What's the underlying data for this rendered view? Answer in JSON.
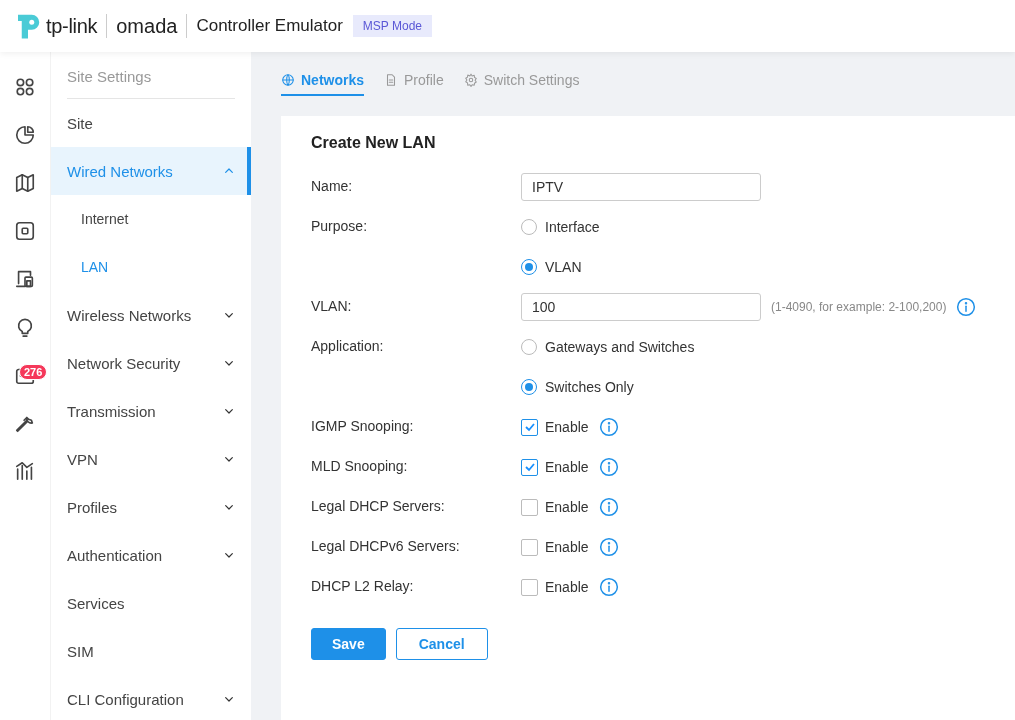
{
  "header": {
    "brand": "tp-link",
    "product": "omada",
    "title": "Controller Emulator",
    "mode_badge": "MSP Mode"
  },
  "rail": [
    {
      "kind": "dashboard"
    },
    {
      "kind": "statistics"
    },
    {
      "kind": "map"
    },
    {
      "kind": "devices"
    },
    {
      "kind": "clients"
    },
    {
      "kind": "insights"
    },
    {
      "kind": "logs",
      "badge": "276"
    },
    {
      "kind": "tools"
    },
    {
      "kind": "reports"
    }
  ],
  "sidebar": {
    "heading": "Site Settings",
    "items": [
      {
        "label": "Site",
        "kind": "link",
        "selected": false
      },
      {
        "label": "Wired Networks",
        "kind": "group",
        "selected": true,
        "expanded": true,
        "children": [
          {
            "label": "Internet",
            "selected": false
          },
          {
            "label": "LAN",
            "selected": true
          }
        ]
      },
      {
        "label": "Wireless Networks",
        "kind": "group",
        "selected": false,
        "expanded": false
      },
      {
        "label": "Network Security",
        "kind": "group",
        "selected": false,
        "expanded": false
      },
      {
        "label": "Transmission",
        "kind": "group",
        "selected": false,
        "expanded": false
      },
      {
        "label": "VPN",
        "kind": "group",
        "selected": false,
        "expanded": false
      },
      {
        "label": "Profiles",
        "kind": "group",
        "selected": false,
        "expanded": false
      },
      {
        "label": "Authentication",
        "kind": "group",
        "selected": false,
        "expanded": false
      },
      {
        "label": "Services",
        "kind": "link",
        "selected": false
      },
      {
        "label": "SIM",
        "kind": "link",
        "selected": false
      },
      {
        "label": "CLI Configuration",
        "kind": "group",
        "selected": false,
        "expanded": false
      }
    ]
  },
  "tabs": [
    {
      "label": "Networks",
      "kind": "globe",
      "selected": true
    },
    {
      "label": "Profile",
      "kind": "document",
      "selected": false
    },
    {
      "label": "Switch Settings",
      "kind": "gear",
      "selected": false
    }
  ],
  "form": {
    "title": "Create New LAN",
    "rows": [
      {
        "label": "Name:",
        "kind": "text",
        "value": "IPTV",
        "info": false
      },
      {
        "label": "Purpose:",
        "kind": "radio",
        "options": [
          {
            "label": "Interface",
            "selected": false
          },
          {
            "label": "VLAN",
            "selected": true
          }
        ]
      },
      {
        "label": "VLAN:",
        "kind": "text",
        "value": "100",
        "hint": "(1-4090, for example: 2-100,200)",
        "info": true
      },
      {
        "label": "Application:",
        "kind": "radio",
        "options": [
          {
            "label": "Gateways and Switches",
            "selected": false
          },
          {
            "label": "Switches Only",
            "selected": true
          }
        ]
      },
      {
        "label": "IGMP Snooping:",
        "kind": "checkbox",
        "option": "Enable",
        "checked": true,
        "info": true
      },
      {
        "label": "MLD Snooping:",
        "kind": "checkbox",
        "option": "Enable",
        "checked": true,
        "info": true
      },
      {
        "label": "Legal DHCP Servers:",
        "kind": "checkbox",
        "option": "Enable",
        "checked": false,
        "info": true
      },
      {
        "label": "Legal DHCPv6 Servers:",
        "kind": "checkbox",
        "option": "Enable",
        "checked": false,
        "info": true
      },
      {
        "label": "DHCP L2 Relay:",
        "kind": "checkbox",
        "option": "Enable",
        "checked": false,
        "info": true
      }
    ],
    "buttons": [
      {
        "label": "Save",
        "kind": "primary"
      },
      {
        "label": "Cancel",
        "kind": "secondary"
      }
    ]
  }
}
